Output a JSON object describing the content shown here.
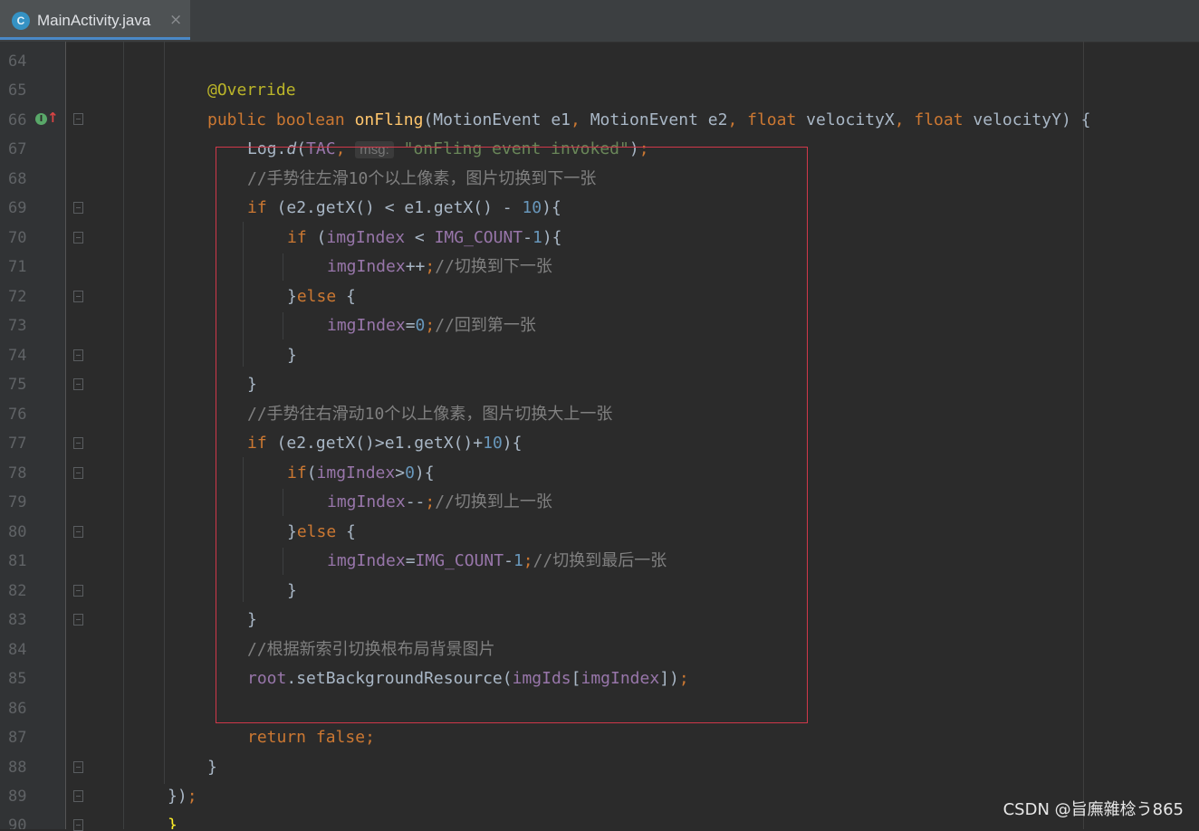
{
  "tab": {
    "icon_letter": "C",
    "file_name": "MainActivity.java",
    "close_glyph": "×"
  },
  "line_numbers": [
    "64",
    "65",
    "66",
    "67",
    "68",
    "69",
    "70",
    "71",
    "72",
    "73",
    "74",
    "75",
    "76",
    "77",
    "78",
    "79",
    "80",
    "81",
    "82",
    "83",
    "84",
    "85",
    "86",
    "87",
    "88",
    "89",
    "90"
  ],
  "gutter": {
    "implements_icon": "implements-method-icon"
  },
  "code": {
    "l65": {
      "annotation": "@Override"
    },
    "l66": {
      "kw_public": "public",
      "kw_boolean": "boolean",
      "method": "onFling",
      "paren_open": "(",
      "type1": "MotionEvent",
      "param1": " e1",
      "comma1": ", ",
      "type2": "MotionEvent",
      "param2": " e2",
      "comma2": ", ",
      "kw_float1": "float",
      "param3": " velocityX",
      "comma3": ", ",
      "kw_float2": "float",
      "param4": " velocityY",
      "tail": ") {"
    },
    "l67": {
      "cls": "Log.",
      "method": "d",
      "paren": "(",
      "field": "TAC",
      "comma": ", ",
      "hint": "msg:",
      "str": "\"onFling event invoked\"",
      "close": ")",
      "semi": ";"
    },
    "l68": {
      "comment": "//手势往左滑10个以上像素，图片切换到下一张"
    },
    "l69": {
      "kw": "if",
      "text1": " (e2.getX() < e1.getX() - ",
      "num": "10",
      "text2": "){"
    },
    "l70": {
      "kw": "if",
      "text1": " (",
      "field1": "imgIndex",
      "text2": " < ",
      "field2": "IMG_COUNT",
      "text3": "-",
      "num": "1",
      "text4": "){"
    },
    "l71": {
      "field": "imgIndex",
      "op": "++",
      "semi": ";",
      "comment": "//切换到下一张"
    },
    "l72": {
      "brace": "}",
      "kw": "else",
      "tail": " {"
    },
    "l73": {
      "field": "imgIndex",
      "op": "=",
      "num": "0",
      "semi": ";",
      "comment": "//回到第一张"
    },
    "l74": {
      "brace": "}"
    },
    "l75": {
      "brace": "}"
    },
    "l76": {
      "comment": "//手势往右滑动10个以上像素，图片切换大上一张"
    },
    "l77": {
      "kw": "if",
      "text1": " (e2.getX()>e1.getX()+",
      "num": "10",
      "text2": "){"
    },
    "l78": {
      "kw": "if",
      "text1": "(",
      "field": "imgIndex",
      "text2": ">",
      "num": "0",
      "text3": "){"
    },
    "l79": {
      "field": "imgIndex",
      "op": "--",
      "semi": ";",
      "comment": "//切换到上一张"
    },
    "l80": {
      "brace": "}",
      "kw": "else",
      "tail": " {"
    },
    "l81": {
      "field1": "imgIndex",
      "op": "=",
      "field2": "IMG_COUNT",
      "minus": "-",
      "num": "1",
      "semi": ";",
      "comment": "//切换到最后一张"
    },
    "l82": {
      "brace": "}"
    },
    "l83": {
      "brace": "}"
    },
    "l84": {
      "comment": "//根据新索引切换根布局背景图片"
    },
    "l85": {
      "field1": "root",
      "text1": ".setBackgroundResource(",
      "field2": "imgIds",
      "br_open": "[",
      "field3": "imgIndex",
      "br_close": "]",
      "close": ")",
      "semi": ";"
    },
    "l87": {
      "kw_return": "return",
      "kw_false": " false",
      "semi": ";"
    },
    "l88": {
      "brace": "}"
    },
    "l89": {
      "text": "})",
      "semi": ";"
    },
    "l90": {
      "brace": "}"
    }
  },
  "watermark": "CSDN @旨廡雜棯う865",
  "colors": {
    "background": "#2b2b2b",
    "keyword": "#cc7832",
    "string": "#6a8759",
    "number": "#6897bb",
    "field": "#9876aa",
    "comment": "#808080",
    "method": "#ffc66d",
    "annotation": "#bbb529",
    "highlight_border": "#d0384a"
  }
}
